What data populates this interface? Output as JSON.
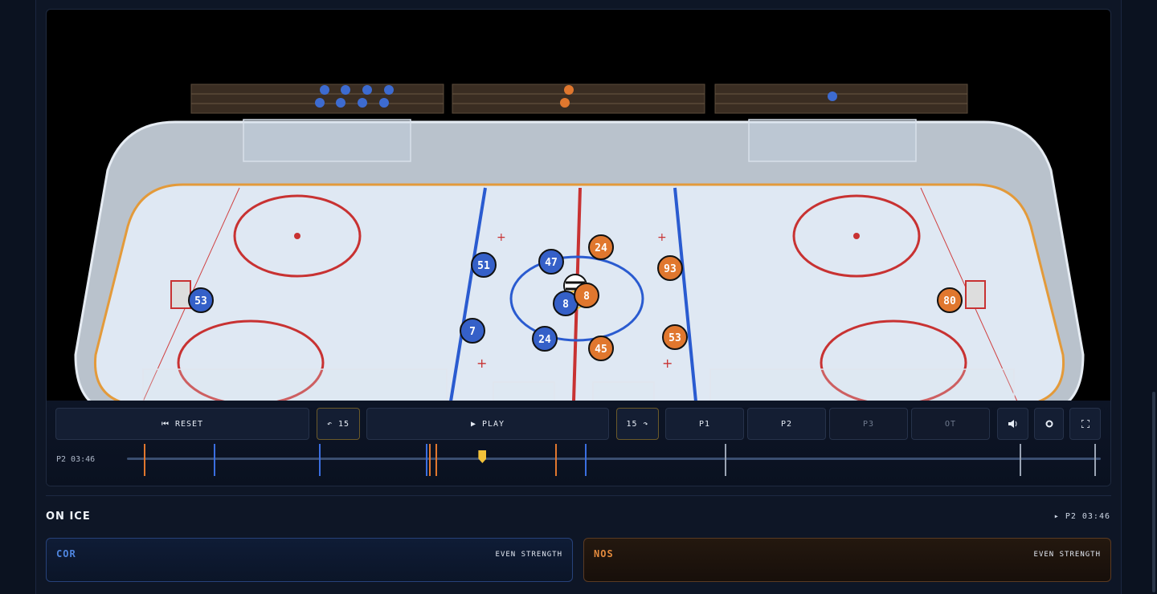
{
  "controls": {
    "reset_label": "⏮ RESET",
    "back_label": "↶ 15",
    "play_label": "▶ PLAY",
    "fwd_label": "15 ↷",
    "periods": [
      "P1",
      "P2",
      "P3",
      "OT"
    ],
    "volume_icon": "speaker-icon",
    "settings_icon": "gear-icon",
    "fullscreen_icon": "fullscreen-icon"
  },
  "timeline": {
    "current_time": "P2 03:46",
    "progress_fraction": 0.365,
    "events": [
      {
        "team": "NOS",
        "pos": 0.017
      },
      {
        "team": "COR",
        "pos": 0.089
      },
      {
        "team": "COR",
        "pos": 0.197
      },
      {
        "team": "COR",
        "pos": 0.307
      },
      {
        "team": "NOS",
        "pos": 0.31
      },
      {
        "team": "NOS",
        "pos": 0.317
      },
      {
        "team": "NOS",
        "pos": 0.44
      },
      {
        "team": "COR",
        "pos": 0.47
      },
      {
        "team": "period",
        "pos": 0.614
      },
      {
        "team": "period",
        "pos": 0.917
      },
      {
        "team": "period",
        "pos": 0.993
      }
    ]
  },
  "colors": {
    "cor": "#3560c8",
    "nos": "#e0772e",
    "ice": "#dfe8f3",
    "red_line": "#c83232",
    "blue_line": "#2a5bd0"
  },
  "rink": {
    "players": [
      {
        "team": "COR",
        "number": "53"
      },
      {
        "team": "COR",
        "number": "51"
      },
      {
        "team": "COR",
        "number": "47"
      },
      {
        "team": "COR",
        "number": "7"
      },
      {
        "team": "COR",
        "number": "24"
      },
      {
        "team": "COR",
        "number": "8"
      },
      {
        "team": "NOS",
        "number": "24"
      },
      {
        "team": "NOS",
        "number": "93"
      },
      {
        "team": "NOS",
        "number": "45"
      },
      {
        "team": "NOS",
        "number": "53"
      },
      {
        "team": "NOS",
        "number": "80"
      },
      {
        "team": "NOS",
        "number": "8"
      }
    ]
  },
  "onice": {
    "title": "ON ICE",
    "clock": "▸ P2 03:46",
    "home": {
      "abbr": "COR",
      "status": "EVEN STRENGTH"
    },
    "away": {
      "abbr": "NOS",
      "status": "EVEN STRENGTH"
    }
  }
}
